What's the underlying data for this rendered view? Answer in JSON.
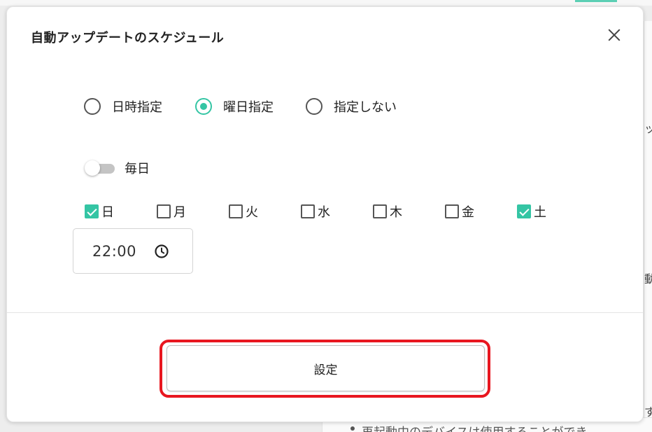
{
  "modal": {
    "title": "自動アップデートのスケジュール",
    "close_label": "×",
    "schedule_mode": {
      "options": [
        {
          "label": "日時指定",
          "checked": false
        },
        {
          "label": "曜日指定",
          "checked": true
        },
        {
          "label": "指定しない",
          "checked": false
        }
      ]
    },
    "everyday": {
      "label": "毎日",
      "on": false
    },
    "days": [
      {
        "label": "日",
        "checked": true
      },
      {
        "label": "月",
        "checked": false
      },
      {
        "label": "火",
        "checked": false
      },
      {
        "label": "水",
        "checked": false
      },
      {
        "label": "木",
        "checked": false
      },
      {
        "label": "金",
        "checked": false
      },
      {
        "label": "土",
        "checked": true
      }
    ],
    "time": {
      "value": "22:00",
      "icon": "clock-icon"
    },
    "submit_label": "設定"
  },
  "background": {
    "right_fragments": [
      "ッ",
      "動",
      "す"
    ],
    "bottom_text": "再起動中のデバイスは使用することができ"
  },
  "colors": {
    "accent": "#34c5a4",
    "highlight": "#e8161f"
  }
}
